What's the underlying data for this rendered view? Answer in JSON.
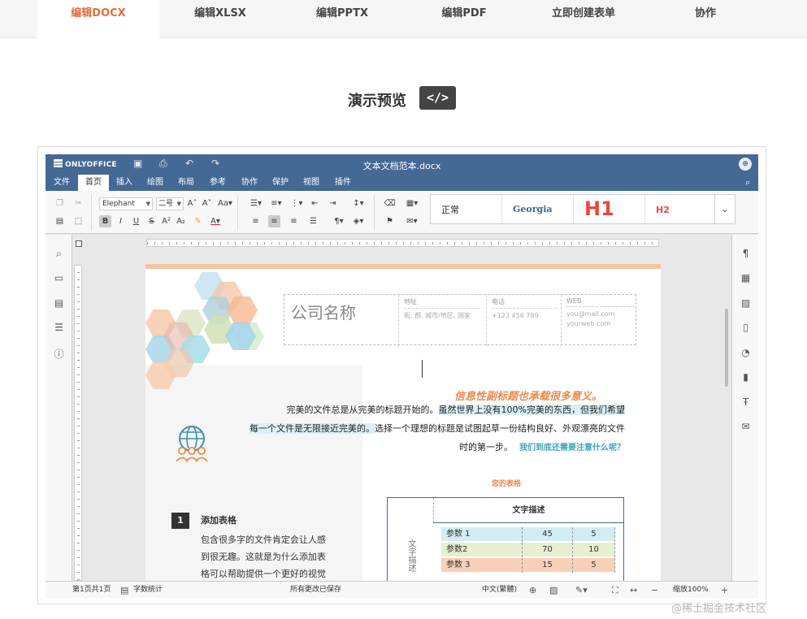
{
  "site_tabs": [
    "编辑DOCX",
    "编辑XLSX",
    "编辑PPTX",
    "编辑PDF",
    "立即创建表单",
    "协作"
  ],
  "demo": {
    "title": "演示预览",
    "code_badge": "</>"
  },
  "editor": {
    "brand": "ONLYOFFICE",
    "doc_title": "文本文档范本.docx",
    "menu": [
      "文件",
      "首页",
      "插入",
      "绘图",
      "布局",
      "参考",
      "协作",
      "保护",
      "视图",
      "插件"
    ],
    "toolbar": {
      "font_name": "Elephant",
      "font_size": "二号",
      "styles": [
        "正常",
        "Georgia",
        "H1",
        "H2"
      ]
    },
    "page": {
      "company_name": "公司名称",
      "info": [
        {
          "header": "地址",
          "lines": [
            "街, 郡, 城市/地区, 国家"
          ]
        },
        {
          "header": "电话",
          "lines": [
            "+123 456 789"
          ]
        },
        {
          "header": "WEB",
          "lines": [
            "you@mail.com",
            "yourweb.com"
          ]
        }
      ],
      "subheading": "信息性副标题也承载很多意义。",
      "para_line1_a": "完美的文件总是从完美的标题开始的。",
      "para_line1_b": "虽然世界上没有100%完美的东西，但我们希望",
      "para_line2_a": "每一个文件是无限接近完美的。",
      "para_line2_b": "选择一个理想的标题是试图起草一份结构良好、外观漂亮的文件",
      "para_line3_a": "时的第一步。",
      "para_line3_b": "我们到底还需要注意什么呢？",
      "section_number": "1",
      "section_title": "添加表格",
      "section_body_lines": [
        "包含很多字的文件肯定会让人感",
        "到很无趣。这就是为什么添加表",
        "格可以帮助提供一个更好的视觉"
      ],
      "table_caption": "您的表格",
      "table_header": "文字描述",
      "table_side_label": "文字描述",
      "table_rows": [
        {
          "label": "参数 1",
          "v1": "45",
          "v2": "5",
          "color": "#d3ecf2"
        },
        {
          "label": "参数2",
          "v1": "70",
          "v2": "10",
          "color": "#e6efcf"
        },
        {
          "label": "参数 3",
          "v1": "15",
          "v2": "5",
          "color": "#f8d0b8"
        }
      ]
    },
    "status": {
      "page_info": "第1页共1页",
      "word_count": "字数统计",
      "save_state": "所有更改已保存",
      "language": "中文(繁體)",
      "zoom": "缩放100%"
    }
  },
  "watermark": "@稀土掘金技术社区",
  "colors": {
    "accent": "#e06d3e",
    "header": "#446995",
    "subheading": "#ee8a4a",
    "link": "#3fa6bf"
  }
}
